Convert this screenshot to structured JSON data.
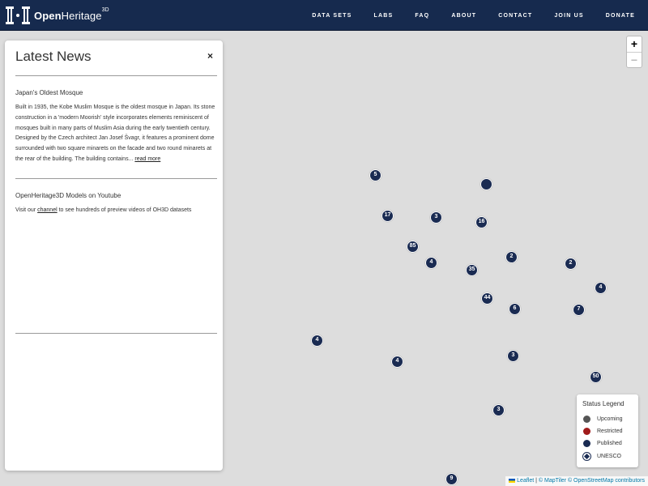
{
  "header": {
    "logo": {
      "prefix": "Open",
      "suffix": "Heritage",
      "sup": "3D"
    },
    "nav": [
      "DATA SETS",
      "LABS",
      "FAQ",
      "ABOUT",
      "CONTACT",
      "JOIN US",
      "DONATE"
    ]
  },
  "news": {
    "title": "Latest News",
    "close": "×",
    "articles": [
      {
        "title": "Japan's Oldest Mosque",
        "body": "Built in 1935, the Kobe Muslim Mosque is the oldest mosque in Japan. Its stone construction in a 'modern Moorish' style incorporates elements reminiscent of mosques built in many parts of Muslim Asia during the early twentieth century. Designed by the Czech architect Jan Josef Švagr, it features a prominent dome surrounded with two square minarets on the facade and two round minarets at the rear of the building. The building contains...",
        "link": "read more"
      },
      {
        "title": "OpenHeritage3D Models on Youtube",
        "body_pre": "Visit our",
        "link": "channel",
        "body_post": "to see hundreds of preview videos of OH3D datasets"
      }
    ]
  },
  "zoom": {
    "in": "+",
    "out": "−"
  },
  "markers": [
    {
      "label": "5"
    },
    {
      "label": ""
    },
    {
      "label": "17"
    },
    {
      "label": "3"
    },
    {
      "label": "16"
    },
    {
      "label": "85"
    },
    {
      "label": "4"
    },
    {
      "label": "35"
    },
    {
      "label": "2"
    },
    {
      "label": "2"
    },
    {
      "label": "4"
    },
    {
      "label": "44"
    },
    {
      "label": "6"
    },
    {
      "label": "7"
    },
    {
      "label": "4"
    },
    {
      "label": "4"
    },
    {
      "label": "3"
    },
    {
      "label": "50"
    },
    {
      "label": "3"
    },
    {
      "label": "9"
    }
  ],
  "legend": {
    "title": "Status Legend",
    "items": [
      {
        "label": "Upcoming",
        "color": "#555555"
      },
      {
        "label": "Restricted",
        "color": "#a01b1b"
      },
      {
        "label": "Published",
        "color": "#1a2b52"
      },
      {
        "label": "UNESCO",
        "icon": "unesco-diamond-icon"
      }
    ]
  },
  "attribution": {
    "leaflet": "Leaflet",
    "separator": "|",
    "maptiler": "© MapTiler",
    "osm": "© OpenStreetMap contributors"
  },
  "colors": {
    "header": "#162a4e",
    "marker": "#1a2b52",
    "map": "#dddddd"
  }
}
